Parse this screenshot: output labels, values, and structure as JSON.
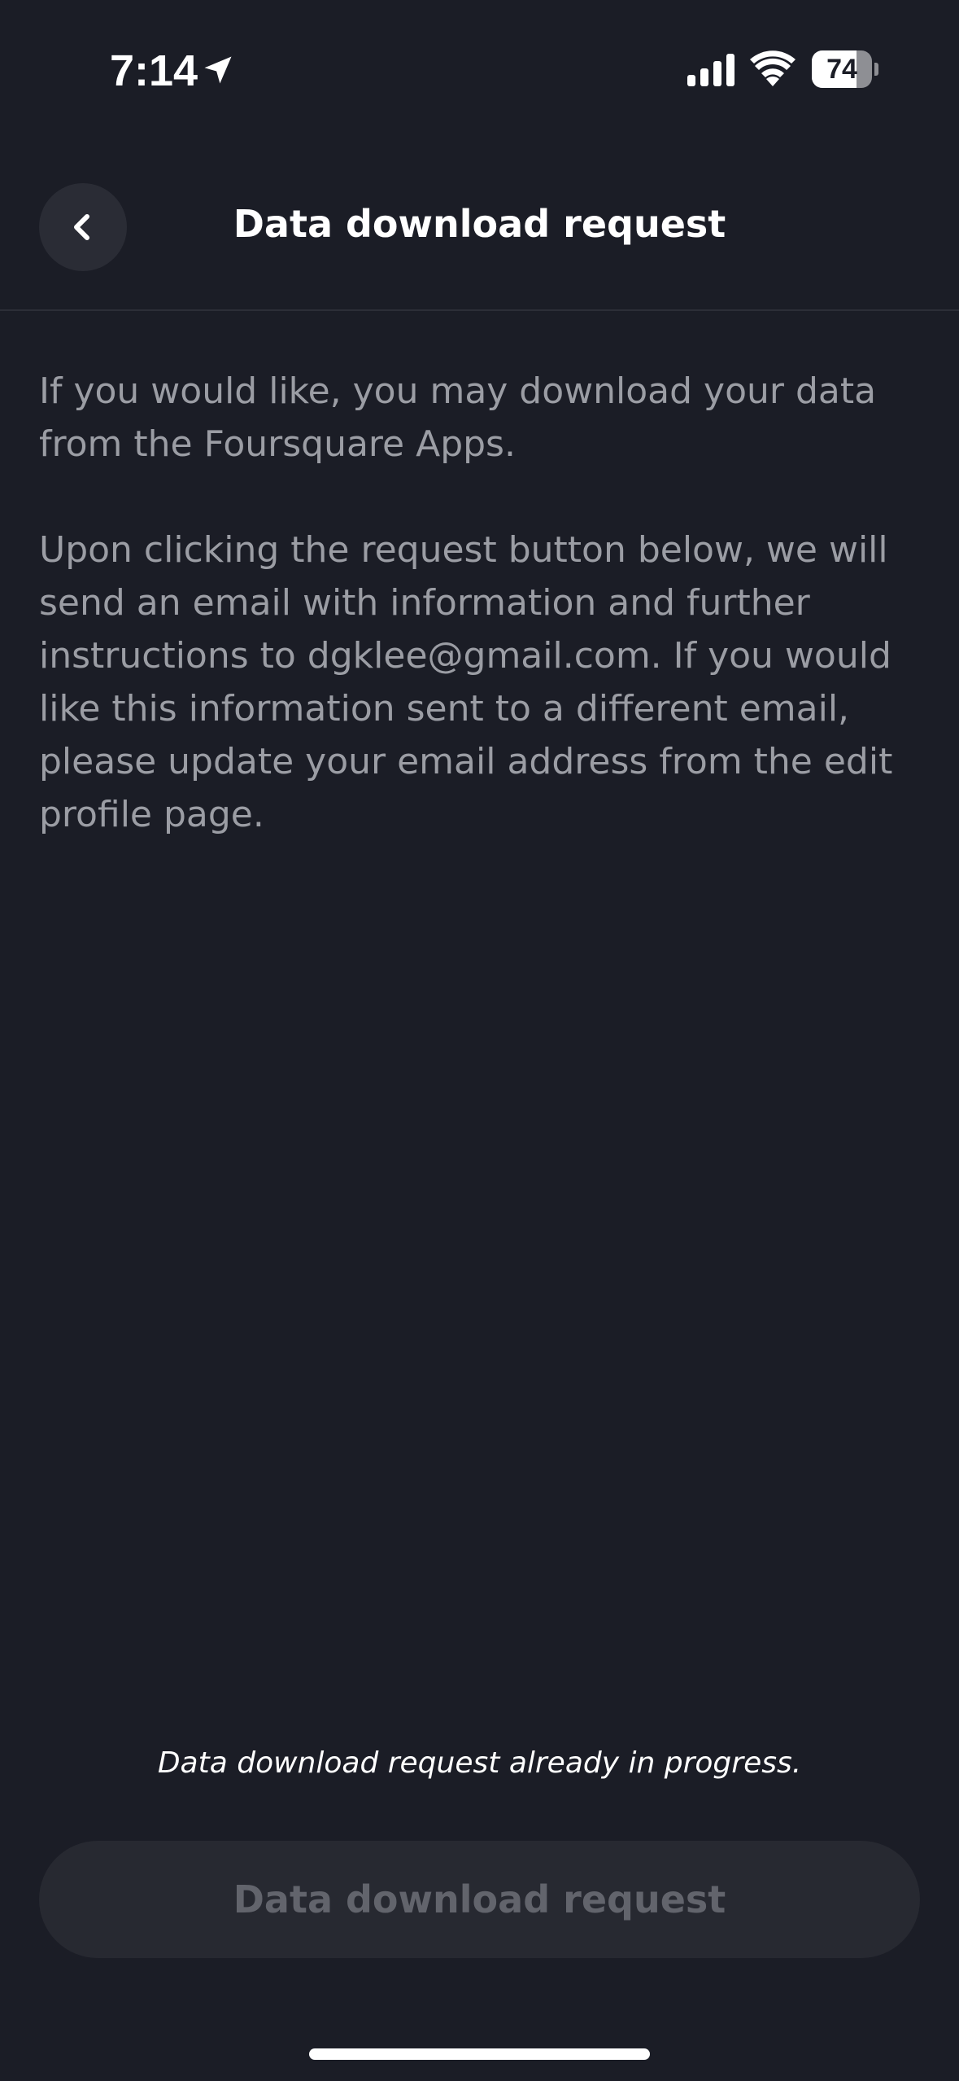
{
  "status_bar": {
    "time": "7:14",
    "battery_level": "74",
    "battery_fraction": 0.74,
    "icons": [
      "location-arrow-icon",
      "cellular-signal-icon",
      "wifi-icon",
      "battery-icon"
    ]
  },
  "header": {
    "back_icon": "chevron-left-icon",
    "title": "Data download request"
  },
  "body": {
    "paragraph_1": "If you would like, you may download your data from the Foursquare Apps.",
    "paragraph_2": "Upon clicking the request button below, we will send an email with information and further instructions to dgklee@gmail.com. If you would like this information sent to a different email, please update your email address from the edit profile page."
  },
  "footer": {
    "status_message": "Data download request already in progress.",
    "button_label": "Data download request",
    "button_disabled": true
  },
  "colors": {
    "background": "#1b1d26",
    "body_text": "#9b9da4",
    "button_background": "#272931",
    "button_text_disabled": "#62646c",
    "divider": "#2c2e37"
  }
}
